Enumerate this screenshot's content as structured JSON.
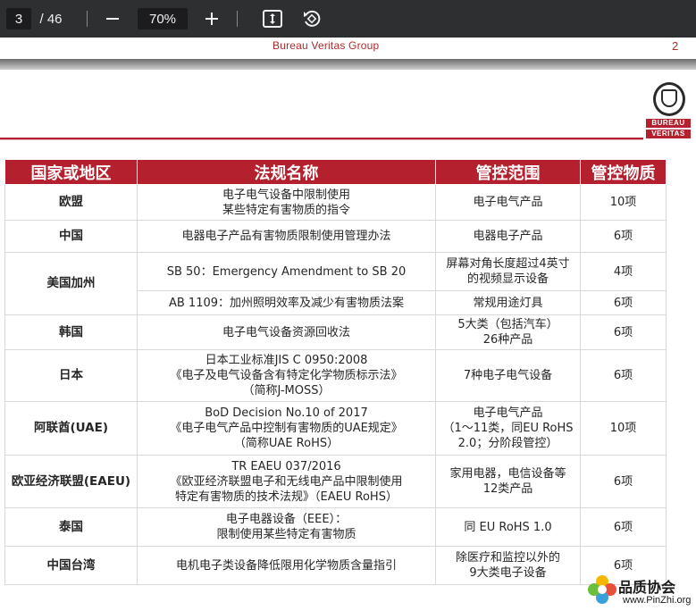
{
  "toolbar": {
    "current_page": "3",
    "page_total": "/ 46",
    "zoom": "70%",
    "icons": [
      "zoom-out-icon",
      "zoom-in-icon",
      "fit-page-icon",
      "rotate-icon"
    ]
  },
  "previous_page": {
    "footer_text": "Bureau Veritas Group",
    "page_number": "2"
  },
  "logo": {
    "seal_text": "BUREAU VERITAS 1828",
    "word_top": "BUREAU",
    "word_bottom": "VERITAS",
    "colors": {
      "accent": "#b5202e"
    }
  },
  "table": {
    "headers": [
      "国家或地区",
      "法规名称",
      "管控范围",
      "管控物质"
    ],
    "rows": [
      {
        "region": "欧盟",
        "regulation": "电子电气设备中限制使用\n某些特定有害物质的指令",
        "scope": "电子电气产品",
        "substances": "10项"
      },
      {
        "region": "中国",
        "regulation": "电器电子产品有害物质限制使用管理办法",
        "scope": "电器电子产品",
        "substances": "6项"
      },
      {
        "region": "美国加州",
        "regulation": "SB 50：Emergency Amendment to SB 20",
        "scope": "屏幕对角长度超过4英寸\n的视频显示设备",
        "substances": "4项"
      },
      {
        "region": "",
        "regulation": "AB 1109：加州照明效率及减少有害物质法案",
        "scope": "常规用途灯具",
        "substances": "6项"
      },
      {
        "region": "韩国",
        "regulation": "电子电气设备资源回收法",
        "scope": "5大类（包括汽车）\n26种产品",
        "substances": "6项"
      },
      {
        "region": "日本",
        "regulation": "日本工业标准JIS C 0950:2008\n《电子及电气设备含有特定化学物质标示法》\n（简称J-MOSS）",
        "scope": "7种电子电气设备",
        "substances": "6项"
      },
      {
        "region": "阿联酋(UAE)",
        "regulation": "BoD Decision No.10 of 2017\n《电子电气产品中控制有害物质的UAE规定》\n（简称UAE RoHS）",
        "scope": "电子电气产品\n（1～11类，同EU RoHS\n2.0；分阶段管控）",
        "substances": "10项"
      },
      {
        "region": "欧亚经济联盟(EAEU)",
        "regulation": "TR EAEU 037/2016\n《欧亚经济联盟电子和无线电产品中限制使用\n特定有害物质的技术法规》（EAEU RoHS）",
        "scope": "家用电器，电信设备等\n12类产品",
        "substances": "6项"
      },
      {
        "region": "泰国",
        "regulation": "电子电器设备（EEE）：\n限制使用某些特定有害物质",
        "scope": "同 EU RoHS 1.0",
        "substances": "6项"
      },
      {
        "region": "中国台湾",
        "regulation": "电机电子类设备降低限用化学物质含量指引",
        "scope": "除医疗和监控以外的\n9大类电子设备",
        "substances": "6项"
      }
    ]
  },
  "watermark": {
    "text": "品质协会",
    "url": "www.PinZhi.org"
  }
}
